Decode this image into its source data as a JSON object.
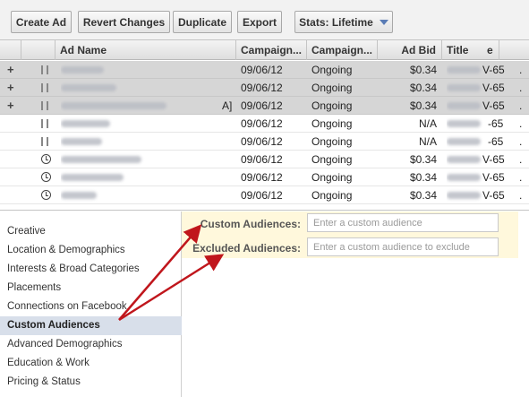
{
  "toolbar": {
    "create_label": "Create Ad",
    "revert_label": "Revert Changes",
    "duplicate_label": "Duplicate",
    "export_label": "Export",
    "stats_label": "Stats: Lifetime"
  },
  "grid": {
    "columns": [
      "Ad Name",
      "Campaign...",
      "Campaign...",
      "Ad Bid",
      "Title"
    ],
    "title_suffix": "e",
    "rows": [
      {
        "icon": "plus-icon",
        "status": "pause-icon",
        "date": "09/06/12",
        "state": "Ongoing",
        "bid": "$0.34",
        "title": "V-65",
        "highlight": true,
        "extra": ""
      },
      {
        "icon": "plus-icon",
        "status": "pause-icon",
        "date": "09/06/12",
        "state": "Ongoing",
        "bid": "$0.34",
        "title": "V-65",
        "highlight": true,
        "extra": ""
      },
      {
        "icon": "plus-icon",
        "status": "pause-icon",
        "date": "09/06/12",
        "state": "Ongoing",
        "bid": "$0.34",
        "title": "V-65",
        "highlight": true,
        "extra": "A]"
      },
      {
        "icon": "",
        "status": "pause-icon",
        "date": "09/06/12",
        "state": "Ongoing",
        "bid": "N/A",
        "title": "-65",
        "highlight": false,
        "extra": ""
      },
      {
        "icon": "",
        "status": "pause-icon",
        "date": "09/06/12",
        "state": "Ongoing",
        "bid": "N/A",
        "title": "-65",
        "highlight": false,
        "extra": ""
      },
      {
        "icon": "",
        "status": "clock-icon",
        "date": "09/06/12",
        "state": "Ongoing",
        "bid": "$0.34",
        "title": "V-65",
        "highlight": false,
        "extra": ""
      },
      {
        "icon": "",
        "status": "clock-icon",
        "date": "09/06/12",
        "state": "Ongoing",
        "bid": "$0.34",
        "title": "V-65",
        "highlight": false,
        "extra": ""
      },
      {
        "icon": "",
        "status": "clock-icon",
        "date": "09/06/12",
        "state": "Ongoing",
        "bid": "$0.34",
        "title": "V-65",
        "highlight": false,
        "extra": ""
      }
    ]
  },
  "sidebar": {
    "items": [
      "Creative",
      "Location & Demographics",
      "Interests & Broad Categories",
      "Placements",
      "Connections on Facebook",
      "Custom Audiences",
      "Advanced Demographics",
      "Education & Work",
      "Pricing & Status"
    ],
    "active_index": 5
  },
  "form": {
    "custom_label": "Custom Audiences:",
    "custom_placeholder": "Enter a custom audience",
    "excluded_label": "Excluded Audiences:",
    "excluded_placeholder": "Enter a custom audience to exclude"
  },
  "colors": {
    "arrow": "#c0161c",
    "panel_bg": "#fff8dc",
    "active_item_bg": "#d8dfea",
    "dropdown_caret": "#5a7cb5"
  }
}
